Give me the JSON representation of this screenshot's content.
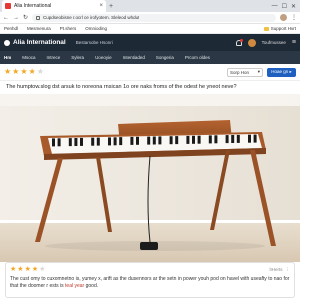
{
  "browser": {
    "tab_title": "Alia International",
    "tab_close": "×",
    "new_tab": "+",
    "controls": [
      "—",
      "☐",
      "✕"
    ],
    "url": "Cupdseobisne r.ocrl ce irofyotem. Sleleod whdut",
    "nav": [
      "←",
      "→",
      "↻"
    ],
    "menu": "⋮"
  },
  "bookmarks": {
    "items": [
      "Penhdl",
      "Mesmenura",
      "Pt.shers",
      "Omnioding"
    ],
    "right_label": "Support Hvrt"
  },
  "site": {
    "brand": "Alia International",
    "header_link": "Bestarsobe Hsonri",
    "user": "Toufmussee",
    "menu_icon": "≡"
  },
  "categories": [
    "Hm",
    "Msoca",
    "Intrece",
    "Sylera",
    "Uoeoyie",
    "Intentiaded",
    "Songeria",
    "Prcom oldes"
  ],
  "rating": {
    "value": 4,
    "max": 5,
    "sort_label": "Sorp Hon",
    "sort_caret": "▾",
    "write_label": "Hoae gn ▸"
  },
  "question": "The humptow.slog dst arsuk to noreona rnsican 1o ore naks froms of the odest he yneot neve?",
  "review": {
    "rating": 4,
    "max": 5,
    "meta": "lIHerts",
    "more": "⋮",
    "body_start": "The cust omy to cuxomnetno is, yumey x, arift as the dusennors ar the setn in power youh pod on havel with useafty to nao for that the doomer r ests is ",
    "body_highlight": "teal year",
    "body_end": " good."
  },
  "colors": {
    "header_bg": "#1e2936",
    "nav_bg": "#2b3744",
    "accent": "#1f5fbf",
    "star": "#f5a623"
  }
}
